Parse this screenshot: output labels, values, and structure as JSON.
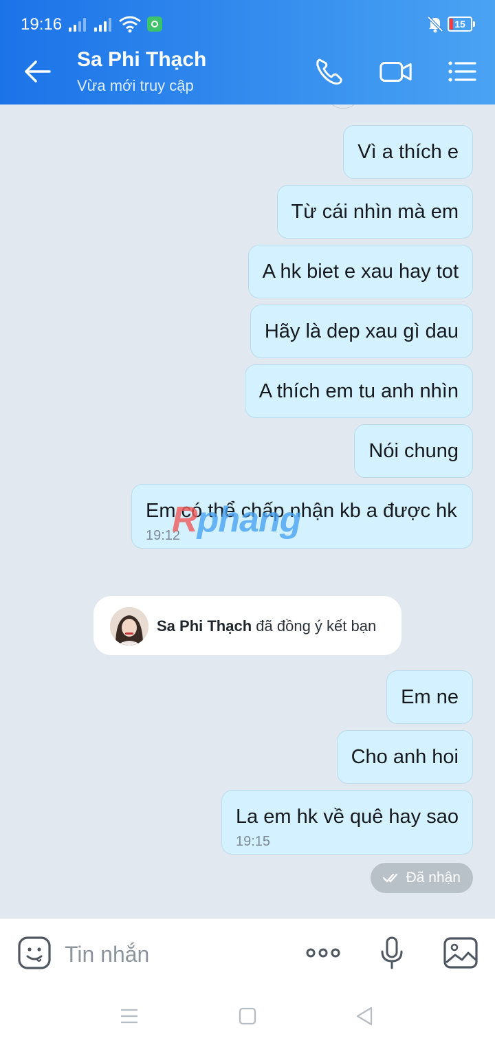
{
  "status_bar": {
    "time": "19:16",
    "battery": "15"
  },
  "header": {
    "contact_name": "Sa Phi Thạch",
    "last_seen": "Vừa mới truy cập",
    "accent_color": "#1b73e8",
    "icons": [
      "back-arrow-icon",
      "phone-call-icon",
      "video-call-icon",
      "menu-list-icon"
    ]
  },
  "messages": [
    {
      "text": "Vì a thích e"
    },
    {
      "text": "Từ cái nhìn mà em"
    },
    {
      "text": "A hk biet e xau hay tot"
    },
    {
      "text": "Hãy là dep xau gì dau"
    },
    {
      "text": "A thích em tu anh nhìn"
    },
    {
      "text": "Nói chung"
    },
    {
      "text": "Em có thể chấp nhận kb a được hk",
      "time": "19:12"
    },
    {
      "text": "Em ne"
    },
    {
      "text": "Cho anh hoi"
    },
    {
      "text": "La em hk về quê hay sao",
      "time": "19:15"
    }
  ],
  "system_notice": {
    "name": "Sa Phi Thạch",
    "text": "đã đồng ý kết bạn"
  },
  "delivery_status": "Đã nhận",
  "watermark": {
    "first": "R",
    "rest": "phang"
  },
  "input_bar": {
    "placeholder": "Tin nhắn",
    "icons": [
      "emoji-icon",
      "more-dots-icon",
      "microphone-icon",
      "image-gallery-icon"
    ]
  },
  "bubble_color": "#d4f1ff"
}
